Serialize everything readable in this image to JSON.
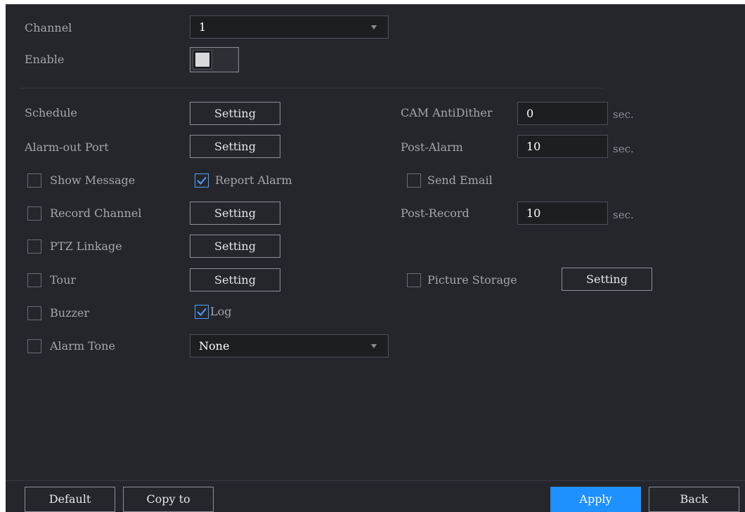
{
  "channel": {
    "label": "Channel",
    "value": "1"
  },
  "enable": {
    "label": "Enable",
    "on": false
  },
  "schedule": {
    "label": "Schedule",
    "button": "Setting"
  },
  "cam_antidither": {
    "label": "CAM AntiDither",
    "value": "0",
    "unit": "sec."
  },
  "alarm_out_port": {
    "label": "Alarm-out Port",
    "button": "Setting"
  },
  "post_alarm": {
    "label": "Post-Alarm",
    "value": "10",
    "unit": "sec."
  },
  "show_message": {
    "label": "Show Message",
    "checked": false
  },
  "report_alarm": {
    "label": "Report Alarm",
    "checked": true
  },
  "send_email": {
    "label": "Send Email",
    "checked": false
  },
  "record_channel": {
    "label": "Record Channel",
    "checked": false,
    "button": "Setting"
  },
  "post_record": {
    "label": "Post-Record",
    "value": "10",
    "unit": "sec."
  },
  "ptz_linkage": {
    "label": "PTZ Linkage",
    "checked": false,
    "button": "Setting"
  },
  "tour": {
    "label": "Tour",
    "checked": false,
    "button": "Setting"
  },
  "picture_storage": {
    "label": "Picture Storage",
    "checked": false,
    "button": "Setting"
  },
  "buzzer": {
    "label": "Buzzer",
    "checked": false
  },
  "log": {
    "label": "Log",
    "checked": true
  },
  "alarm_tone": {
    "label": "Alarm Tone",
    "checked": false,
    "value": "None"
  },
  "footer": {
    "default": "Default",
    "copy_to": "Copy to",
    "apply": "Apply",
    "back": "Back"
  },
  "colors": {
    "panel": "#25262c",
    "accent": "#1e90ff",
    "check": "#4aa0ff"
  }
}
